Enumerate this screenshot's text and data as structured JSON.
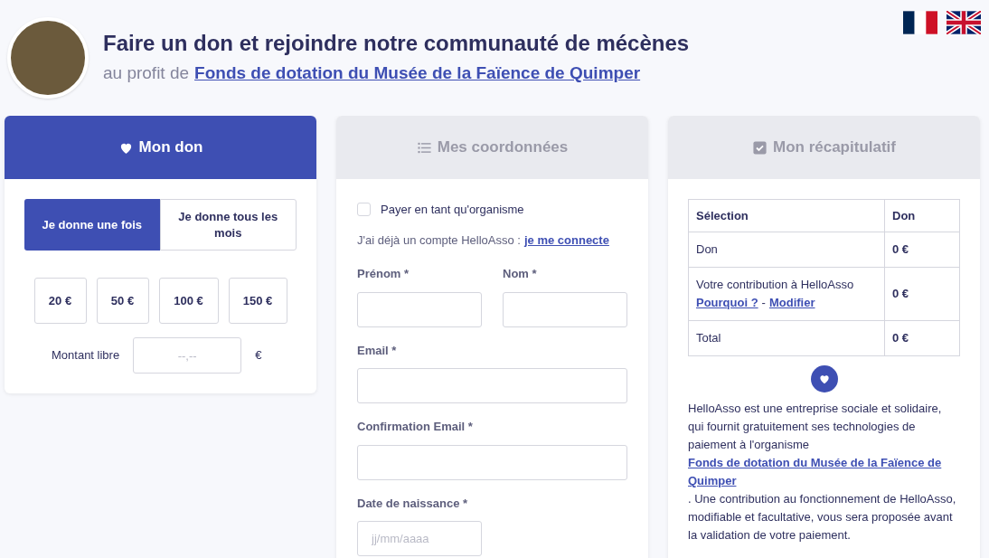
{
  "header": {
    "title": "Faire un don et rejoindre notre communauté de mécènes",
    "subtitle_prefix": "au profit de",
    "subtitle_link": "Fonds de dotation du Musée de la Faïence de Quimper"
  },
  "languages": [
    {
      "kind": "fr"
    },
    {
      "kind": "en"
    }
  ],
  "steps": [
    {
      "title": "Mon don",
      "kind": "heart",
      "selected": true
    },
    {
      "title": "Mes coordonnées",
      "kind": "list",
      "selected": false
    },
    {
      "title": "Mon récapitulatif",
      "kind": "check",
      "selected": false
    }
  ],
  "donation": {
    "frequency": [
      {
        "label": "Je donne une fois",
        "selected": true
      },
      {
        "label": "Je donne tous les mois",
        "selected": false
      }
    ],
    "amounts": [
      {
        "label": "20 €",
        "selected": false
      },
      {
        "label": "50 €",
        "selected": false
      },
      {
        "label": "100 €",
        "selected": false
      },
      {
        "label": "150 €",
        "selected": false
      }
    ],
    "free_amount": {
      "label": "Montant libre",
      "placeholder": "--,--",
      "currency": "€"
    }
  },
  "details": {
    "organization_checkbox": {
      "label": "Payer en tant qu'organisme",
      "checked": false
    },
    "account_prompt": {
      "text": "J'ai déjà un compte HelloAsso :",
      "link": "je me connecte"
    },
    "field_rows": [
      [
        {
          "label": "Prénom *",
          "kind": "text"
        },
        {
          "label": "Nom *",
          "kind": "text"
        }
      ],
      [
        {
          "label": "Email *",
          "kind": "text"
        }
      ],
      [
        {
          "label": "Confirmation Email *",
          "kind": "text"
        }
      ],
      [
        {
          "label": "Date de naissance *",
          "kind": "date",
          "placeholder": "jj/mm/aaaa"
        }
      ]
    ]
  },
  "summary": {
    "columns": [
      "Sélection",
      "Don"
    ],
    "rows": [
      {
        "label": "Don",
        "amount": "0 €"
      },
      {
        "label": "Votre contribution à HelloAsso",
        "links": [
          "Pourquoi ?",
          "Modifier"
        ],
        "separator": "-",
        "amount": "0 €"
      },
      {
        "label": "Total",
        "amount": "0 €"
      }
    ],
    "info_text_1": "HelloAsso est une entreprise sociale et solidaire, qui fournit gratuitement ses technologies de paiement à l'organisme",
    "info_link": "Fonds de dotation du Musée de la Faïence de Quimper",
    "info_text_2": ". Une contribution au fonctionnement de HelloAsso, modifiable et facultative, vous sera proposée avant la validation de votre paiement."
  }
}
